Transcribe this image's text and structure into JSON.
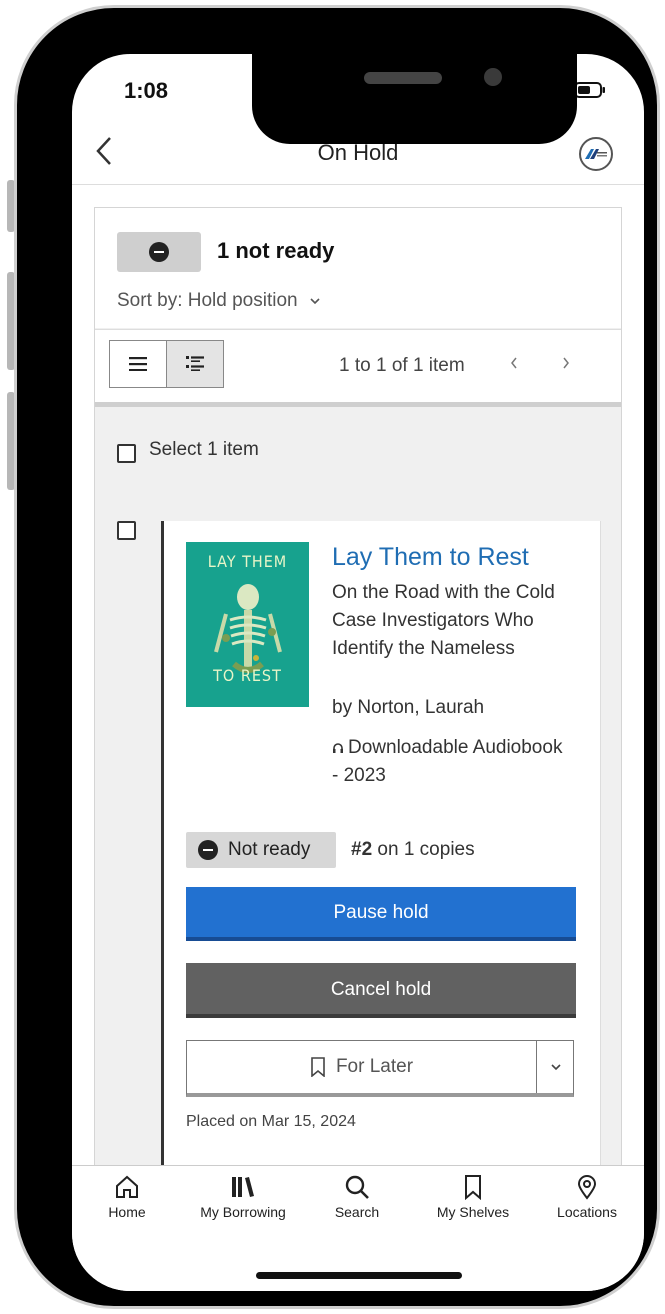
{
  "status_bar": {
    "time": "1:08"
  },
  "header": {
    "title": "On Hold",
    "back_icon": "chevron-left-icon",
    "logo_icon": "library-logo-icon"
  },
  "summary": {
    "status_icon": "minus-circle-icon",
    "not_ready_count": "1 not ready",
    "sort_label": "Sort by: Hold position",
    "sort_icon": "chevron-down-icon"
  },
  "toolbar": {
    "paging_text": "1 to 1 of 1 item",
    "prev_icon": "chevron-left-icon",
    "next_icon": "chevron-right-icon"
  },
  "select_all": {
    "label": "Select 1 item",
    "checked": false
  },
  "items": [
    {
      "checked": false,
      "cover": {
        "title_line1": "LAY THEM",
        "title_line2": "TO REST"
      },
      "title": "Lay Them to Rest",
      "subtitle": "On the Road with the Cold Case Investigators Who Identify the Nameless",
      "author": "by Norton, Laurah",
      "format_icon": "headphones-icon",
      "format": "Downloadable Audiobook - 2023",
      "hold_status": "Not ready",
      "queue_position": "#2",
      "queue_text": "on 1 copies",
      "pause_label": "Pause hold",
      "cancel_label": "Cancel hold",
      "shelf_label": "For Later",
      "placed_on": "Placed on Mar 15, 2024"
    }
  ],
  "tabs": [
    {
      "label": "Home",
      "icon": "home-icon"
    },
    {
      "label": "My Borrowing",
      "icon": "books-icon"
    },
    {
      "label": "Search",
      "icon": "search-icon"
    },
    {
      "label": "My Shelves",
      "icon": "bookmark-icon"
    },
    {
      "label": "Locations",
      "icon": "location-pin-icon"
    }
  ],
  "colors": {
    "primary_button": "#2271d0",
    "secondary_button": "#616161",
    "link": "#1f6db3",
    "cover": "#17a28e"
  }
}
